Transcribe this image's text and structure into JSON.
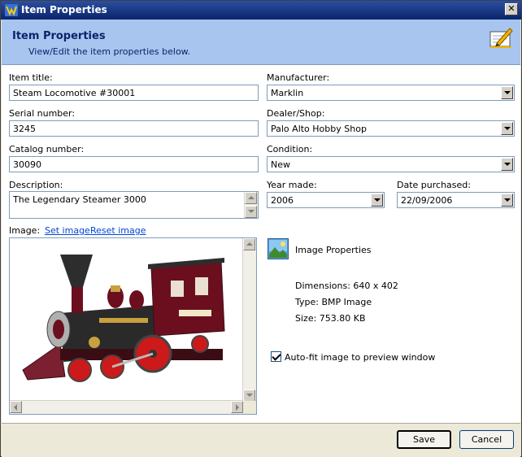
{
  "window": {
    "title": "Item Properties"
  },
  "header": {
    "title": "Item Properties",
    "subtitle": "View/Edit the item properties below."
  },
  "form": {
    "item_title": {
      "label": "Item title:",
      "value": "Steam Locomotive #30001"
    },
    "serial_number": {
      "label": "Serial number:",
      "value": "3245"
    },
    "catalog_number": {
      "label": "Catalog number:",
      "value": "30090"
    },
    "description": {
      "label": "Description:",
      "value": "The Legendary Steamer 3000"
    },
    "manufacturer": {
      "label": "Manufacturer:",
      "value": "Marklin"
    },
    "dealer": {
      "label": "Dealer/Shop:",
      "value": "Palo Alto Hobby Shop"
    },
    "condition": {
      "label": "Condition:",
      "value": "New"
    },
    "year_made": {
      "label": "Year made:",
      "value": "2006"
    },
    "date_purchased": {
      "label": "Date purchased:",
      "value": "22/09/2006"
    }
  },
  "image": {
    "label": "Image:",
    "set_link": "Set image",
    "reset_link": "Reset image",
    "info_title": "Image Properties",
    "dimensions": "Dimensions: 640 x 402",
    "type": "Type: BMP Image",
    "size": "Size: 753.80 KB",
    "autofit_label": "Auto-fit image to preview window",
    "autofit_checked": true
  },
  "buttons": {
    "save": "Save",
    "cancel": "Cancel"
  },
  "colors": {
    "header_bg": "#a7c5ef",
    "titlebar": "#0a246a",
    "link": "#0046d5"
  }
}
